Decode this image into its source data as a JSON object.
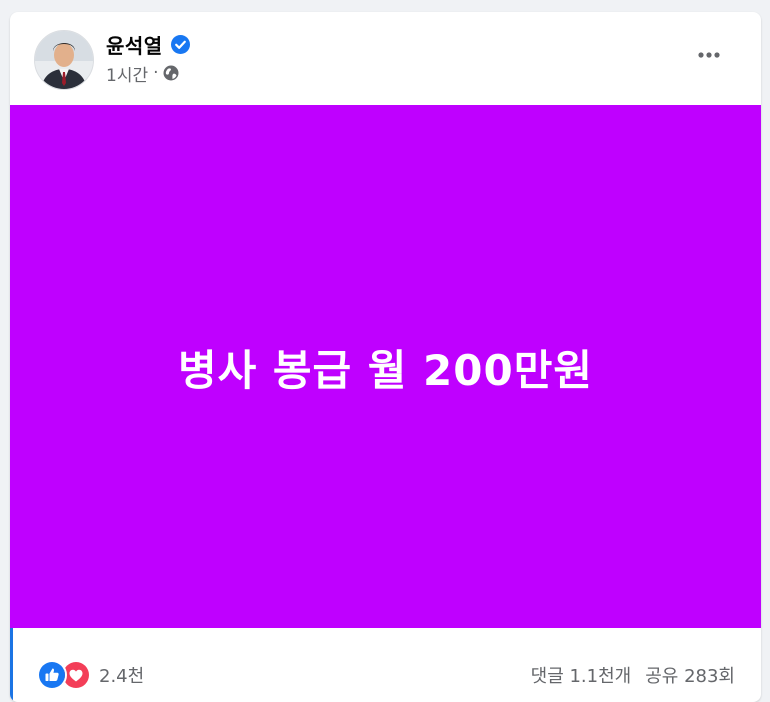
{
  "post": {
    "author_name": "윤석열",
    "timestamp": "1시간",
    "separator": "·",
    "audience_icon": "globe-icon",
    "verified_icon": "verified-badge-icon",
    "more_icon": "more-options-icon",
    "media_text": "병사 봉급 월 200만원",
    "media_bg_color": "#bf00ff"
  },
  "footer": {
    "reaction_icons": [
      "like-icon",
      "love-icon"
    ],
    "reaction_count": "2.4천",
    "comments": "댓글 1.1천개",
    "shares": "공유 283회"
  },
  "colors": {
    "accent": "#1b74e4",
    "like": "#1877f2",
    "love": "#f33e58",
    "secondary_text": "#65676b"
  }
}
